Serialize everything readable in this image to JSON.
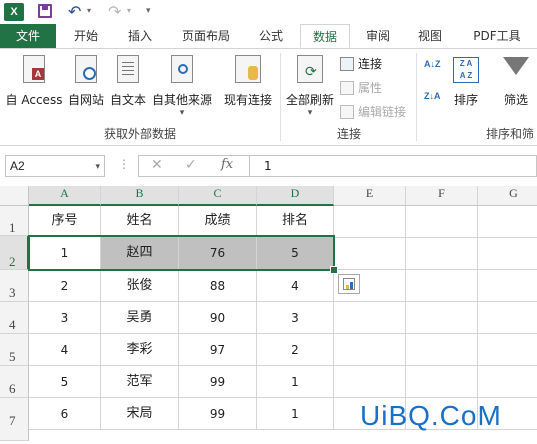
{
  "qat": {
    "app_icon": "X",
    "undo_icon": "undo-icon",
    "redo_icon": "redo-icon"
  },
  "tabs": [
    "文件",
    "开始",
    "插入",
    "页面布局",
    "公式",
    "数据",
    "审阅",
    "视图",
    "PDF工具"
  ],
  "active_tab": "数据",
  "ribbon": {
    "from_access": "自 Access",
    "from_web": "自网站",
    "from_text": "自文本",
    "from_other": "自其他来源",
    "existing_conn": "现有连接",
    "refresh_all": "全部刷新",
    "connections": "连接",
    "properties": "属性",
    "edit_links": "编辑链接",
    "sort": "排序",
    "filter": "筛选",
    "group_get_external": "获取外部数据",
    "group_connections": "连接",
    "group_sort_filter": "排序和筛"
  },
  "formula_bar": {
    "name_box": "A2",
    "fx": "fx",
    "content": "1"
  },
  "columns": [
    "A",
    "B",
    "C",
    "D",
    "E",
    "F",
    "G"
  ],
  "rows": [
    "1",
    "2",
    "3",
    "4",
    "5",
    "6",
    "7"
  ],
  "table": {
    "headers": [
      "序号",
      "姓名",
      "成绩",
      "排名"
    ],
    "rows": [
      [
        "1",
        "赵四",
        "76",
        "5"
      ],
      [
        "2",
        "张俊",
        "88",
        "4"
      ],
      [
        "3",
        "吴勇",
        "90",
        "3"
      ],
      [
        "4",
        "李彩",
        "97",
        "2"
      ],
      [
        "5",
        "范军",
        "99",
        "1"
      ],
      [
        "6",
        "宋局",
        "99",
        "1"
      ]
    ]
  },
  "watermark": "UiBQ.CoM",
  "colors": {
    "accent": "#217346",
    "selection_fill": "#c0c0c0"
  }
}
